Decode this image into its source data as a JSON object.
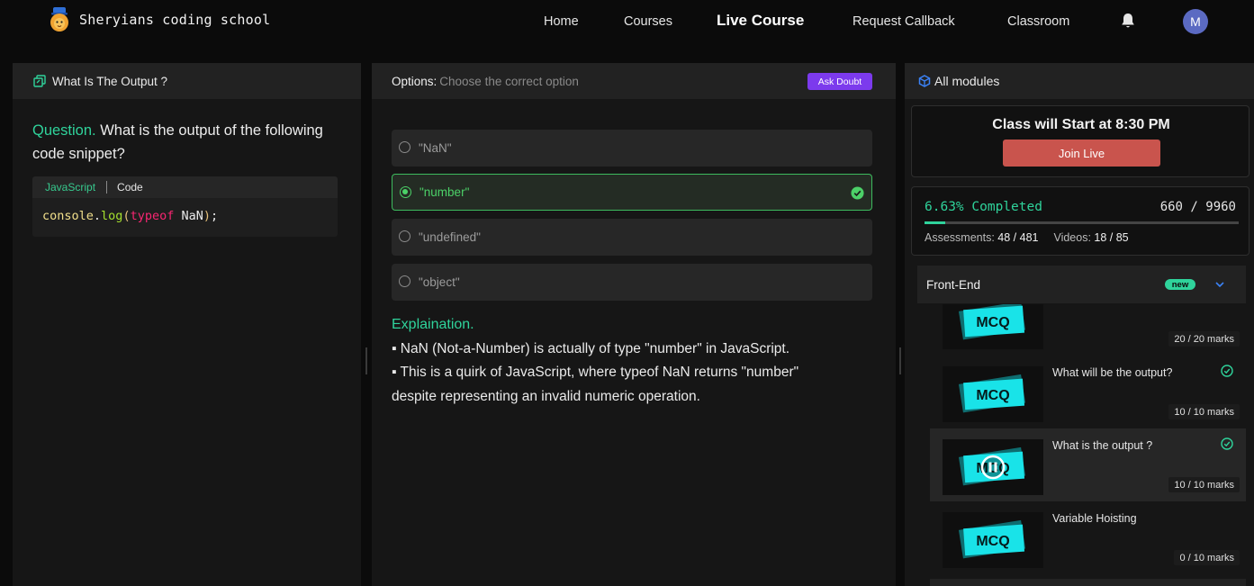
{
  "brand": {
    "name": "Sheryians coding school",
    "logo": "lion-mascot-icon"
  },
  "nav": {
    "home": "Home",
    "courses": "Courses",
    "live_course": "Live Course",
    "request_callback": "Request Callback",
    "classroom": "Classroom",
    "avatar_initial": "M"
  },
  "question_panel": {
    "header": "What Is The Output ?",
    "prefix": "Question.",
    "text": "What is the output of the following code snippet?",
    "code_lang": "JavaScript",
    "code_tab": "Code",
    "code": {
      "obj": "console",
      "dot": ".",
      "fn": "log",
      "open": "(",
      "kw": "typeof",
      "arg": " NaN",
      "close": ")",
      "semi": ";"
    }
  },
  "options_panel": {
    "label": "Options:",
    "sublabel": "Choose the correct option",
    "ask_doubt": "Ask Doubt",
    "options": [
      {
        "text": "\"NaN\"",
        "correct": false
      },
      {
        "text": "\"number\"",
        "correct": true
      },
      {
        "text": "\"undefined\"",
        "correct": false
      },
      {
        "text": "\"object\"",
        "correct": false
      }
    ],
    "explanation_title": "Explaination.",
    "explanation_lines": [
      "▪ NaN (Not-a-Number) is actually of type \"number\" in JavaScript.",
      "▪ This is a quirk of JavaScript, where typeof NaN returns \"number\" despite representing an invalid numeric operation."
    ]
  },
  "modules_panel": {
    "header": "All modules",
    "class_start": "Class will Start at 8:30 PM",
    "join_live": "Join Live",
    "completed": "6.63% Completed",
    "progress_fraction": 0.0663,
    "ratio": "660 / 9960",
    "assessments_label": "Assessments:",
    "assessments_value": "48 / 481",
    "videos_label": "Videos:",
    "videos_value": "18 / 85",
    "section_title": "Front-End",
    "section_badge": "new",
    "lessons": [
      {
        "title": "",
        "marks": "20 / 20 marks",
        "done": false,
        "active": false,
        "thumb_text": "MCQ"
      },
      {
        "title": "What will be the output?",
        "marks": "10 / 10 marks",
        "done": true,
        "active": false,
        "thumb_text": "MCQ"
      },
      {
        "title": "What is the output ?",
        "marks": "10 / 10 marks",
        "done": true,
        "active": true,
        "thumb_text": "MCQ"
      },
      {
        "title": "Variable Hoisting",
        "marks": "0 / 10 marks",
        "done": false,
        "active": false,
        "thumb_text": "MCQ"
      }
    ]
  },
  "colors": {
    "accent_green": "#2fd39b",
    "correct_green": "#4cd168",
    "ask_purple": "#7c3aed",
    "join_red": "#c9544d",
    "mcq_cyan": "#19e3e8"
  }
}
